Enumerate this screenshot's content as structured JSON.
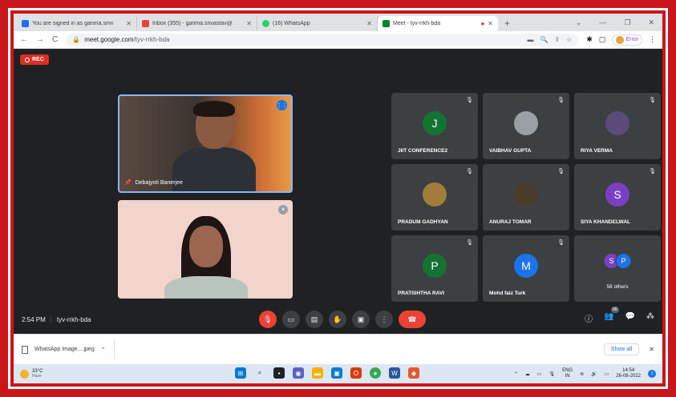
{
  "browser": {
    "tabs": [
      {
        "title": "You are signed in as garima.srivi",
        "favicon_color": "#1a73e8"
      },
      {
        "title": "Inbox (355) - garima.srivastav@",
        "favicon_color": "#ea4335"
      },
      {
        "title": "(16) WhatsApp",
        "favicon_color": "#25d366"
      },
      {
        "title": "Meet - tyv-rrkh-bda",
        "favicon_color": "#00832d"
      }
    ],
    "url_domain": "meet.google.com",
    "url_path": "/tyv-rrkh-bda",
    "profile_label": "Error"
  },
  "meet": {
    "rec_label": "REC",
    "speaker_name": "Debajyoti Banerjee",
    "participants": [
      {
        "name": "JIIT CONFERENCE2",
        "initial": "J",
        "avatar_color": "#137333"
      },
      {
        "name": "VAIBHAV GUPTA",
        "initial": "",
        "avatar_color": "#9aa0a6"
      },
      {
        "name": "RIYA VERMA",
        "initial": "",
        "avatar_color": "#5b4a7a"
      },
      {
        "name": "PRADUM GADHYAN",
        "initial": "",
        "avatar_color": "#a37b3c"
      },
      {
        "name": "ANURAJ TOMAR",
        "initial": "",
        "avatar_color": "#4a3b2a"
      },
      {
        "name": "SIYA KHANDELWAL",
        "initial": "S",
        "avatar_color": "#7b3fc4"
      },
      {
        "name": "PRATISHTHA RAVI",
        "initial": "P",
        "avatar_color": "#137333"
      },
      {
        "name": "Mohd faiz Turk",
        "initial": "M",
        "avatar_color": "#1a73e8"
      }
    ],
    "others_label": "58 others",
    "others_initials": [
      "S",
      "P"
    ],
    "others_colors": [
      "#7b3fc4",
      "#1a73e8"
    ],
    "time": "2:54 PM",
    "meeting_code": "tyv-rrkh-bda",
    "people_count": "66"
  },
  "download": {
    "file_name": "WhatsApp Image....jpeg",
    "show_all": "Show all"
  },
  "taskbar": {
    "temperature": "33°C",
    "weather_desc": "Haze",
    "lang_top": "ENG",
    "lang_bottom": "IN",
    "clock_time": "14:54",
    "clock_date": "26-08-2022",
    "notification_count": "1"
  }
}
